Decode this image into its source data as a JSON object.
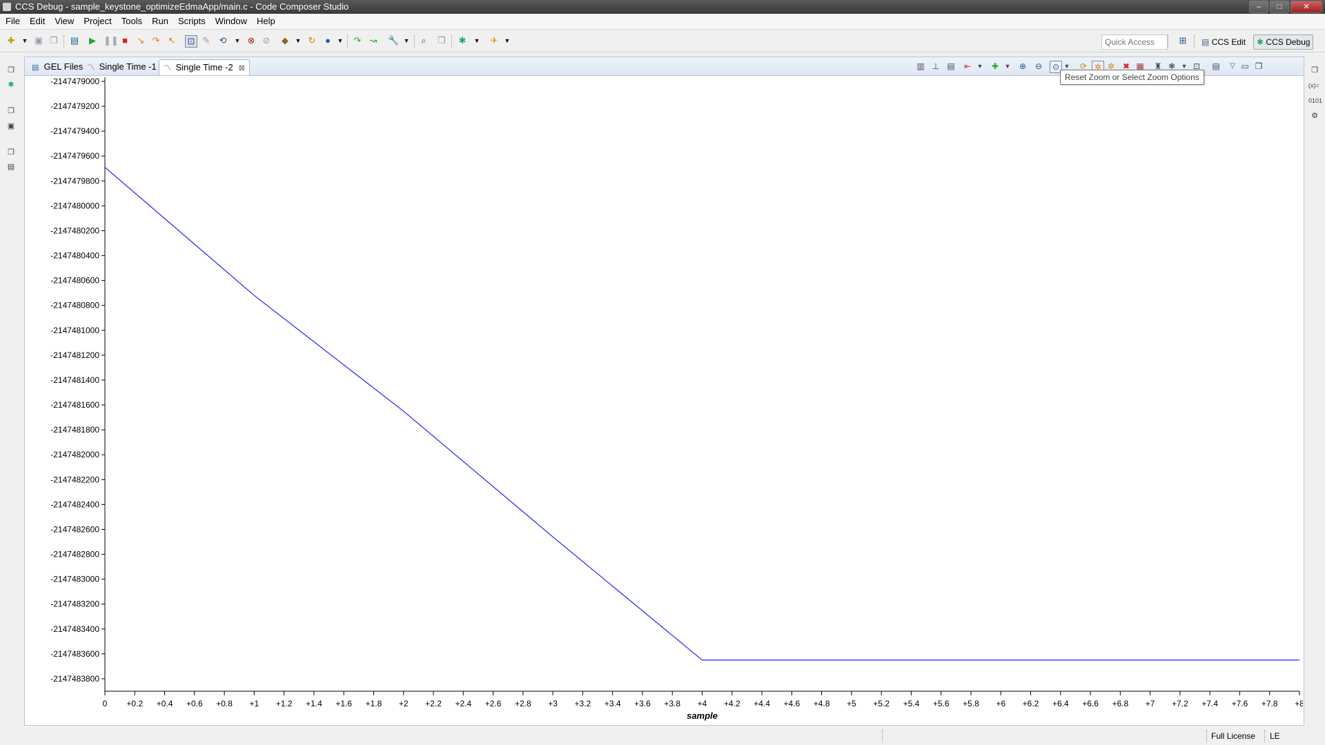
{
  "window": {
    "title": "CCS Debug - sample_keystone_optimizeEdmaApp/main.c - Code Composer Studio"
  },
  "menu": [
    "File",
    "Edit",
    "View",
    "Project",
    "Tools",
    "Run",
    "Scripts",
    "Window",
    "Help"
  ],
  "toolbar": {
    "quick_access_placeholder": "Quick Access",
    "perspectives": [
      "CCS Edit",
      "CCS Debug"
    ]
  },
  "tabs": [
    {
      "label": "GEL Files",
      "icon": "gel-files-icon"
    },
    {
      "label": "Single Time -1",
      "icon": "graph-icon"
    },
    {
      "label": "Single Time -2",
      "icon": "graph-icon",
      "active": true
    }
  ],
  "tooltip": "Reset Zoom or Select Zoom Options",
  "status": {
    "license": "Full License",
    "endian": "LE"
  },
  "colors": {
    "series": "#2020ff",
    "axis": "#000000"
  },
  "chart_data": {
    "type": "line",
    "xlabel": "sample",
    "ylabel": "",
    "xlim": [
      0,
      8
    ],
    "ylim": [
      -2147483900,
      -2147479000
    ],
    "x_ticks": [
      "0",
      "+0.2",
      "+0.4",
      "+0.6",
      "+0.8",
      "+1",
      "+1.2",
      "+1.4",
      "+1.6",
      "+1.8",
      "+2",
      "+2.2",
      "+2.4",
      "+2.6",
      "+2.8",
      "+3",
      "+3.2",
      "+3.4",
      "+3.6",
      "+3.8",
      "+4",
      "+4.2",
      "+4.4",
      "+4.6",
      "+4.8",
      "+5",
      "+5.2",
      "+5.4",
      "+5.6",
      "+5.8",
      "+6",
      "+6.2",
      "+6.4",
      "+6.6",
      "+6.8",
      "+7",
      "+7.2",
      "+7.4",
      "+7.6",
      "+7.8",
      "+8"
    ],
    "y_ticks": [
      "-2147479000",
      "-2147479200",
      "-2147479400",
      "-2147479600",
      "-2147479800",
      "-2147480000",
      "-2147480200",
      "-2147480400",
      "-2147480600",
      "-2147480800",
      "-2147481000",
      "-2147481200",
      "-2147481400",
      "-2147481600",
      "-2147481800",
      "-2147482000",
      "-2147482200",
      "-2147482400",
      "-2147482600",
      "-2147482800",
      "-2147483000",
      "-2147483200",
      "-2147483400",
      "-2147483600",
      "-2147483800"
    ],
    "series": [
      {
        "x": [
          0,
          1,
          2,
          3,
          4,
          5,
          6,
          7,
          8
        ],
        "y": [
          -2147479690,
          -2147480720,
          -2147481650,
          -2147482660,
          -2147483650,
          -2147483650,
          -2147483650,
          -2147483650,
          -2147483650
        ]
      }
    ],
    "grid": false
  }
}
